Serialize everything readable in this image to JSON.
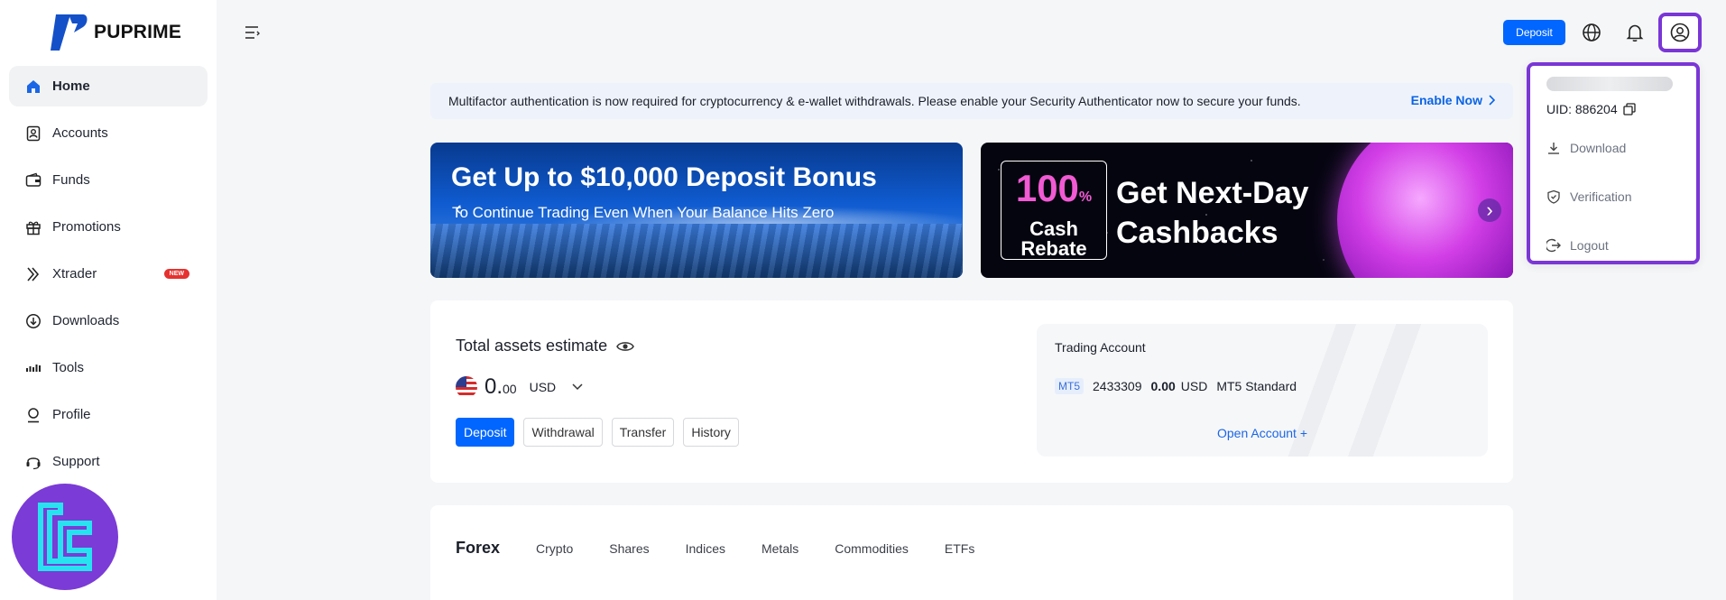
{
  "brand": {
    "name": "PUPRIME"
  },
  "sidebar": {
    "items": [
      {
        "label": "Home",
        "icon": "home-icon",
        "active": true
      },
      {
        "label": "Accounts",
        "icon": "accounts-icon"
      },
      {
        "label": "Funds",
        "icon": "wallet-icon"
      },
      {
        "label": "Promotions",
        "icon": "gift-icon"
      },
      {
        "label": "Xtrader",
        "icon": "xtrader-icon",
        "badge": "NEW"
      },
      {
        "label": "Downloads",
        "icon": "download-icon"
      },
      {
        "label": "Tools",
        "icon": "tools-icon"
      },
      {
        "label": "Profile",
        "icon": "profile-icon"
      },
      {
        "label": "Support",
        "icon": "headset-icon"
      }
    ]
  },
  "topbar": {
    "deposit_label": "Deposit"
  },
  "dropdown": {
    "uid": "UID: 886204",
    "items": [
      {
        "label": "Download",
        "icon": "download-icon"
      },
      {
        "label": "Verification",
        "icon": "shield-icon"
      },
      {
        "label": "Logout",
        "icon": "logout-icon"
      }
    ]
  },
  "alert": {
    "message": "Multifactor authentication is now required for cryptocurrency & e-wallet withdrawals. Please enable your Security Authenticator now to secure your funds.",
    "link": "Enable Now"
  },
  "banners": [
    {
      "title": "Get Up to $10,000 Deposit Bonus",
      "subtitle": "To Continue Trading Even When Your Balance Hits Zero"
    },
    {
      "badge_pct": "100",
      "badge_pct_unit": "%",
      "badge_line1": "Cash",
      "badge_line2": "Rebate",
      "title": "Get Next-Day Cashbacks"
    }
  ],
  "assets": {
    "title": "Total assets estimate",
    "balance_int": "0.",
    "balance_dec": "00",
    "currency": "USD",
    "buttons": [
      "Deposit",
      "Withdrawal",
      "Transfer",
      "History"
    ]
  },
  "trading": {
    "title": "Trading Account",
    "platform": "MT5",
    "account_number": "2433309",
    "balance": "0.00",
    "currency": "USD",
    "account_type": "MT5 Standard",
    "open_account": "Open Account +"
  },
  "markets": {
    "tabs": [
      "Forex",
      "Crypto",
      "Shares",
      "Indices",
      "Metals",
      "Commodities",
      "ETFs"
    ]
  },
  "colors": {
    "accent": "#0066ff",
    "highlight": "#7a36d6",
    "badge": "#e5312f",
    "link": "#0a63e6"
  }
}
